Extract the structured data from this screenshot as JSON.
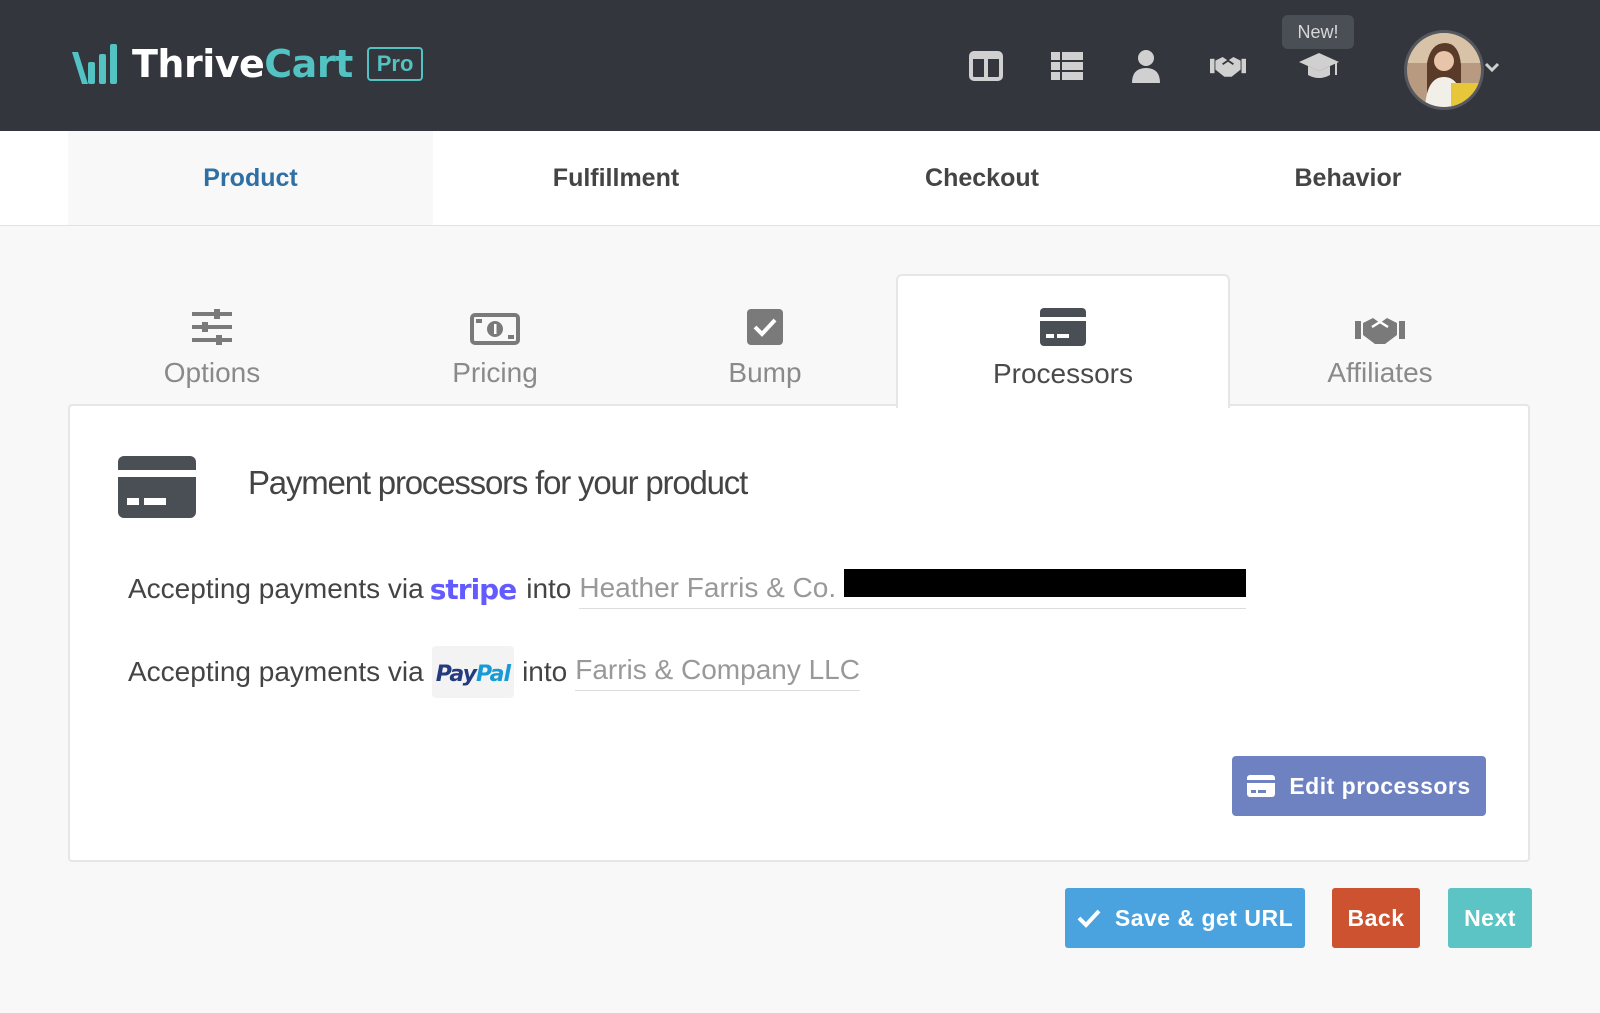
{
  "header": {
    "brand_part1": "Thrive",
    "brand_part2": "Cart",
    "plan_badge": "Pro",
    "new_badge": "New!",
    "nav_icons": [
      "layout-icon",
      "list-icon",
      "user-icon",
      "handshake-icon",
      "graduation-cap-icon"
    ]
  },
  "main_tabs": [
    {
      "label": "Product",
      "active": true
    },
    {
      "label": "Fulfillment",
      "active": false
    },
    {
      "label": "Checkout",
      "active": false
    },
    {
      "label": "Behavior",
      "active": false
    }
  ],
  "sub_tabs": [
    {
      "label": "Options",
      "icon": "sliders-icon",
      "active": false
    },
    {
      "label": "Pricing",
      "icon": "money-bill-icon",
      "active": false
    },
    {
      "label": "Bump",
      "icon": "checkbox-icon",
      "active": false
    },
    {
      "label": "Processors",
      "icon": "credit-card-icon",
      "active": true
    },
    {
      "label": "Affiliates",
      "icon": "handshake-icon",
      "active": false
    }
  ],
  "panel": {
    "title": "Payment processors for your product",
    "processors": [
      {
        "prefix": "Accepting payments via",
        "processor": "stripe",
        "connector": "into",
        "account": "Heather Farris & Co."
      },
      {
        "prefix": "Accepting payments via",
        "processor_part1": "Pay",
        "processor_part2": "Pal",
        "connector": "into",
        "account": "Farris & Company LLC"
      }
    ],
    "edit_button": "Edit processors"
  },
  "actions": {
    "save": "Save & get URL",
    "back": "Back",
    "next": "Next"
  },
  "colors": {
    "header_bg": "#33363c",
    "accent_teal": "#52c2c3",
    "active_tab": "#2f6fa4",
    "save_blue": "#4aa3df",
    "back_red": "#cc5230",
    "next_teal": "#5cc4c5",
    "edit_purple": "#6e81c1",
    "stripe": "#635bff"
  }
}
